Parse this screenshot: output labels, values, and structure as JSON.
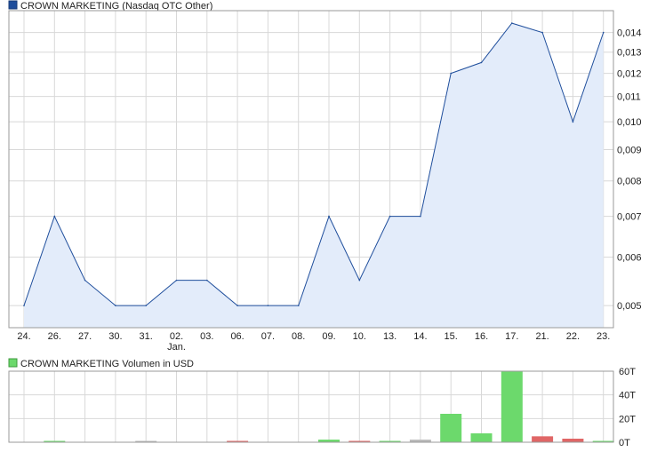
{
  "colors": {
    "price_line": "#1f4e9c",
    "price_fill": "#e3ecfa",
    "grid": "#d8d8d8",
    "frame": "#9a9a9a",
    "vol_up": "#6cd96c",
    "vol_down": "#e06666",
    "vol_neutral": "#bbbbbb"
  },
  "chart_data": [
    {
      "type": "area",
      "legend": "CROWN MARKETING (Nasdaq OTC Other)",
      "scale": "log",
      "categories": [
        "24.",
        "26.",
        "27.",
        "30.",
        "31.",
        "02.",
        "03.",
        "06.",
        "07.",
        "08.",
        "09.",
        "10.",
        "13.",
        "14.",
        "15.",
        "16.",
        "17.",
        "21.",
        "22.",
        "23."
      ],
      "category_sublabels": [
        {
          "index": 5,
          "text": "Jan."
        }
      ],
      "yticks": [
        "0,005",
        "0,006",
        "0,007",
        "0,008",
        "0,009",
        "0,010",
        "0,011",
        "0,012",
        "0,013",
        "0,014"
      ],
      "ytick_values": [
        0.005,
        0.006,
        0.007,
        0.008,
        0.009,
        0.01,
        0.011,
        0.012,
        0.013,
        0.014
      ],
      "ylim": [
        0.0046,
        0.0152
      ],
      "grid": true,
      "series": [
        {
          "values": [
            0.005,
            0.007,
            0.0055,
            0.005,
            0.005,
            0.0055,
            0.0055,
            0.005,
            0.005,
            0.005,
            0.007,
            0.0055,
            0.007,
            0.007,
            0.012,
            0.0125,
            0.0145,
            0.014,
            0.01,
            0.014
          ]
        }
      ]
    },
    {
      "type": "bar",
      "legend": "CROWN MARKETING Volumen in USD",
      "categories": [
        "24.",
        "26.",
        "27.",
        "30.",
        "31.",
        "02.",
        "03.",
        "06.",
        "07.",
        "08.",
        "09.",
        "10.",
        "13.",
        "14.",
        "15.",
        "16.",
        "17.",
        "21.",
        "22.",
        "23."
      ],
      "yticks": [
        "0T",
        "20T",
        "40T",
        "60T"
      ],
      "ytick_values": [
        0,
        20000,
        40000,
        60000
      ],
      "ylim": [
        0,
        60000
      ],
      "grid": true,
      "series": [
        {
          "values": [
            0,
            800,
            0,
            0,
            500,
            0,
            0,
            600,
            0,
            0,
            2200,
            800,
            900,
            2200,
            24000,
            7500,
            60000,
            5000,
            3000,
            800
          ],
          "direction": [
            "none",
            "up",
            "none",
            "none",
            "neutral",
            "none",
            "none",
            "down",
            "none",
            "none",
            "up",
            "down",
            "up",
            "neutral",
            "up",
            "up",
            "up",
            "down",
            "down",
            "up"
          ]
        }
      ]
    }
  ]
}
